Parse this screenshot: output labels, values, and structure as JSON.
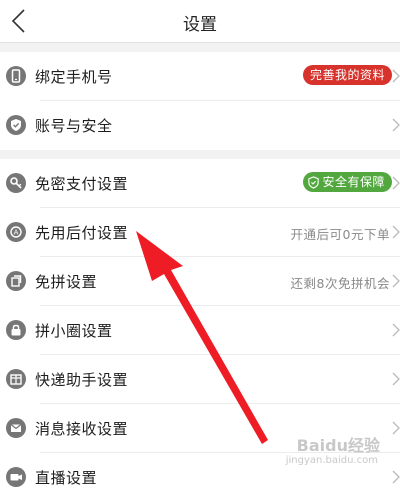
{
  "header": {
    "title": "设置",
    "back_icon": "back-chevron-icon"
  },
  "sections": [
    {
      "items": [
        {
          "label": "绑定手机号",
          "icon": "phone-icon",
          "badge": "完善我的资料",
          "badge_color": "#d8322c"
        },
        {
          "label": "账号与安全",
          "icon": "shield-check-icon"
        }
      ]
    },
    {
      "items": [
        {
          "label": "免密支付设置",
          "icon": "key-icon",
          "badge": "安全有保障",
          "badge_color": "#52a83f"
        },
        {
          "label": "先用后付设置",
          "icon": "pay-later-icon",
          "hint": "开通后可0元下单"
        },
        {
          "label": "免拼设置",
          "icon": "copy-icon",
          "hint": "还剩8次免拼机会"
        },
        {
          "label": "拼小圈设置",
          "icon": "lock-bag-icon"
        },
        {
          "label": "快递助手设置",
          "icon": "package-icon"
        },
        {
          "label": "消息接收设置",
          "icon": "mail-icon"
        },
        {
          "label": "直播设置",
          "icon": "camera-icon"
        }
      ]
    }
  ],
  "annotation": {
    "type": "red-arrow",
    "target": "先用后付设置"
  },
  "watermark": {
    "text": "Baidu经验",
    "sub": "jingyan.baidu.com"
  },
  "colors": {
    "accent_red": "#d8322c",
    "accent_green": "#52a83f",
    "icon_gray": "#767676",
    "arrow": "#ee1c25"
  }
}
